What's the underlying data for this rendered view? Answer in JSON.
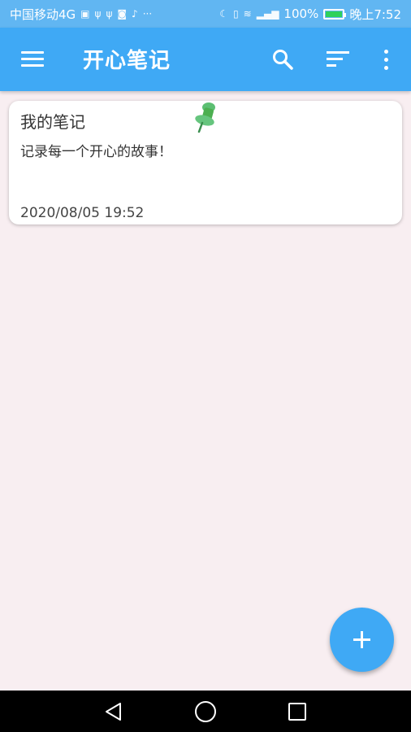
{
  "status_bar": {
    "carrier": "中国移动4G",
    "dots": "···",
    "battery": "100%",
    "time": "晚上7:52"
  },
  "app_bar": {
    "title": "开心笔记"
  },
  "notes": [
    {
      "title": "我的笔记",
      "content": "记录每一个开心的故事！",
      "date": "2020/08/05 19:52"
    }
  ],
  "colors": {
    "primary": "#3fa9f5",
    "status_bar": "#61b6f2",
    "background": "#f8eef1",
    "pin": "#4caf50"
  }
}
